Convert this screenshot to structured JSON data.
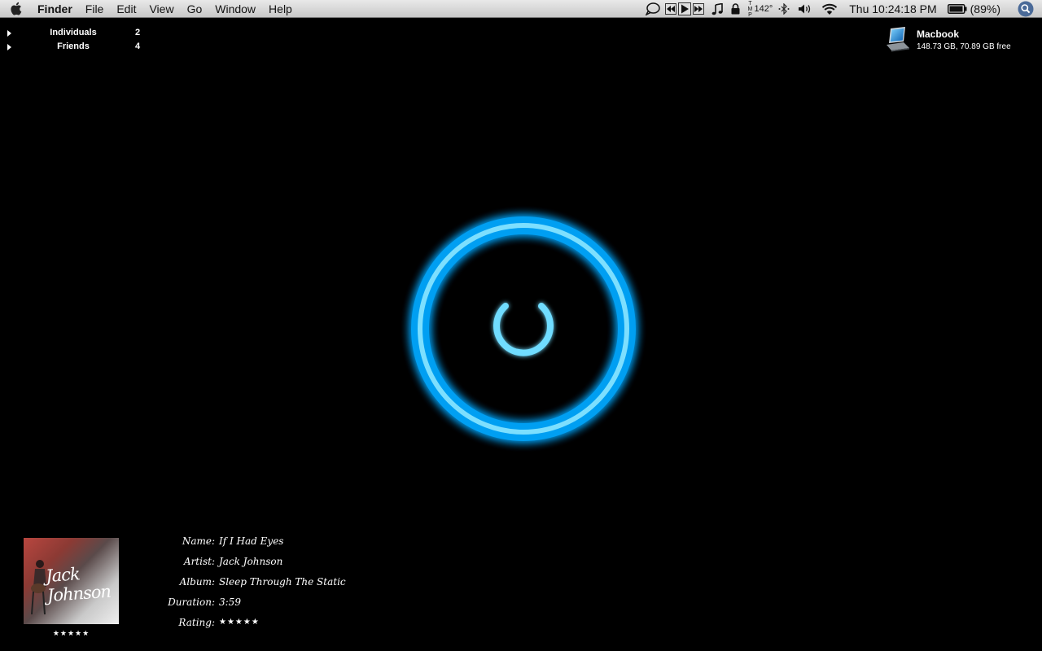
{
  "menubar": {
    "app_name": "Finder",
    "menus": [
      "File",
      "Edit",
      "View",
      "Go",
      "Window",
      "Help"
    ],
    "temperature": "142°",
    "clock": "Thu 10:24:18 PM",
    "battery_percent": "(89%)",
    "icons": [
      "apple-icon",
      "chat-bubble-icon",
      "rewind-icon",
      "play-icon",
      "fast-forward-icon",
      "music-note-icon",
      "lock-icon",
      "temperature-icon",
      "bluetooth-icon",
      "volume-icon",
      "wifi-icon",
      "battery-icon",
      "spotlight-icon"
    ]
  },
  "groups": [
    {
      "name": "Individuals",
      "count": "2"
    },
    {
      "name": "Friends",
      "count": "4"
    }
  ],
  "disk": {
    "name": "Macbook",
    "info": "148.73 GB, 70.89 GB free"
  },
  "now_playing": {
    "labels": {
      "name": "Name:",
      "artist": "Artist:",
      "album": "Album:",
      "duration": "Duration:",
      "rating": "Rating:"
    },
    "name": "If I Had Eyes",
    "artist": "Jack Johnson",
    "album": "Sleep Through The Static",
    "duration": "3:59",
    "rating": "★★★★★",
    "artwork_text": "Jack Johnson",
    "artwork_rating": "★★★★★"
  },
  "colors": {
    "glow": "#00b7ff",
    "ring": "#3fd4ff",
    "background": "#000000"
  }
}
